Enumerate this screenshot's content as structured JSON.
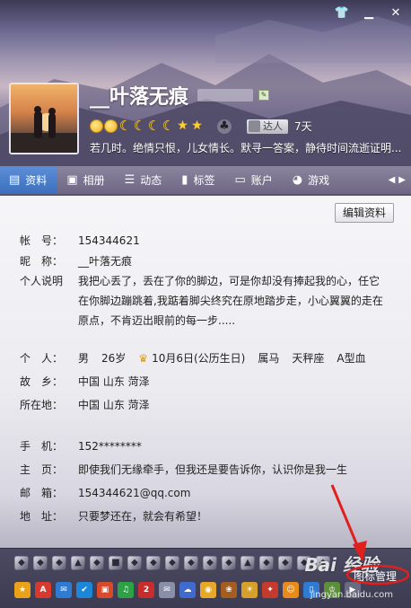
{
  "header": {
    "nickname": "__叶落无痕",
    "days": "7天",
    "daren_label": "达人",
    "signature": "若几时。绝情只恨，儿女情长。默寻一答案，静待时间流逝证明..."
  },
  "tabs": [
    {
      "label": "资料",
      "icon": "profile-icon"
    },
    {
      "label": "相册",
      "icon": "photo-icon"
    },
    {
      "label": "动态",
      "icon": "feed-icon"
    },
    {
      "label": "标签",
      "icon": "bookmark-icon"
    },
    {
      "label": "账户",
      "icon": "wallet-icon"
    },
    {
      "label": "游戏",
      "icon": "game-icon"
    }
  ],
  "profile": {
    "edit_label": "编辑资料",
    "account_label": "帐　号：",
    "account": "154344621",
    "nick_label": "昵　称：",
    "nick": "__叶落无痕",
    "intro_label": "个人说明",
    "intro": "我把心丢了，丢在了你的脚边，可是你却没有捧起我的心，任它在你脚边蹦跳着,我踮着脚尖终究在原地踏步走，小心翼翼的走在原点，不肯迈出眼前的每一步.....",
    "personal_label": "个　人：",
    "gender": "男",
    "age": "26岁",
    "birthday": "10月6日(公历生日)",
    "zodiac": "属马",
    "constellation": "天秤座",
    "blood": "A型血",
    "hometown_label": "故　乡：",
    "hometown": "中国 山东 菏泽",
    "location_label": "所在地：",
    "location": "中国 山东 菏泽",
    "mobile_label": "手　机：",
    "mobile": "152********",
    "homepage_label": "主　页：",
    "homepage": "即使我们无缘牵手，但我还是要告诉你，认识你是我一生",
    "email_label": "邮　箱：",
    "email": "154344621@qq.com",
    "address_label": "地　址：",
    "address": "只要梦还在，就会有希望！"
  },
  "bottom": {
    "icon_manage_label": "图标管理",
    "watermark": "Bai 经验",
    "watermark_sub": "jingyan.baidu.com"
  },
  "colors": {
    "tab_active": "#3d6fbd",
    "annotation_red": "#e0201c"
  }
}
